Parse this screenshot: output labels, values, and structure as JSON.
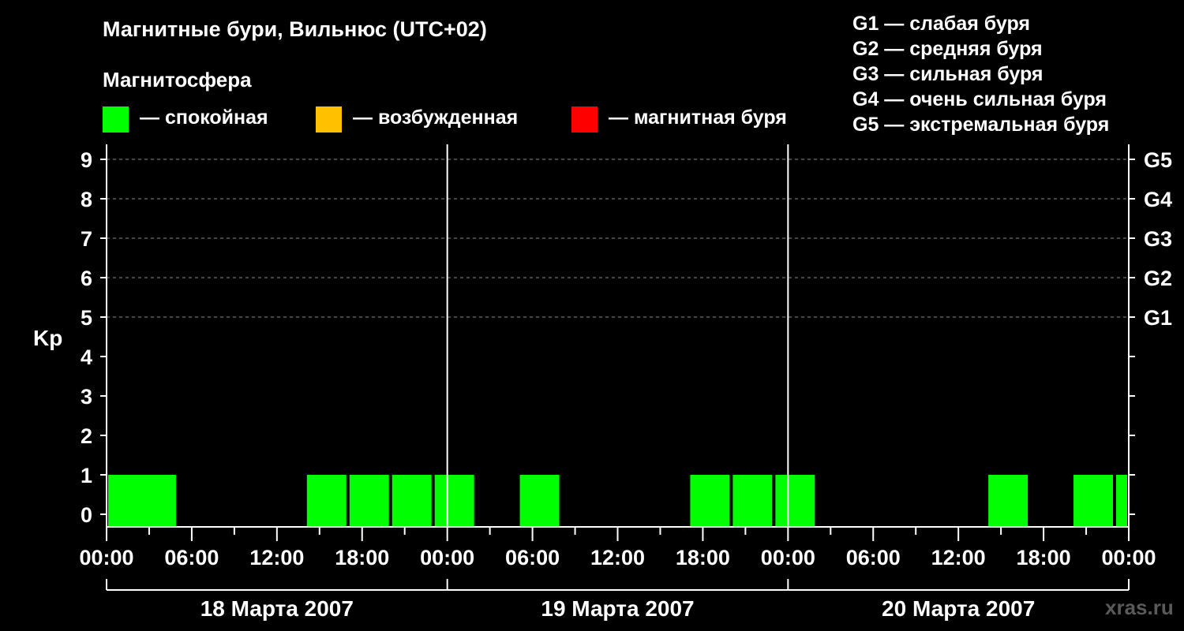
{
  "header": {
    "title": "Магнитные бури, Вильнюс (UTC+02)",
    "subtitle": "Магнитосфера",
    "watermark": "xras.ru"
  },
  "legend": [
    {
      "label": "— спокойная",
      "color": "#00ff00"
    },
    {
      "label": "— возбужденная",
      "color": "#ffc000"
    },
    {
      "label": "— магнитная буря",
      "color": "#ff0000"
    }
  ],
  "g_legend": [
    "G1 — слабая буря",
    "G2 — средняя буря",
    "G3 — сильная буря",
    "G4 — очень сильная буря",
    "G5 — экстремальная буря"
  ],
  "chart_data": {
    "type": "bar",
    "ylabel": "Kp",
    "ylim": [
      0,
      9
    ],
    "y_ticks": [
      "0",
      "1",
      "2",
      "3",
      "4",
      "5",
      "6",
      "7",
      "8",
      "9"
    ],
    "right_ticks": [
      {
        "kp": 5,
        "label": "G1"
      },
      {
        "kp": 6,
        "label": "G2"
      },
      {
        "kp": 7,
        "label": "G3"
      },
      {
        "kp": 8,
        "label": "G4"
      },
      {
        "kp": 9,
        "label": "G5"
      }
    ],
    "x_tick_labels": [
      "00:00",
      "06:00",
      "12:00",
      "18:00",
      "00:00",
      "06:00",
      "12:00",
      "18:00",
      "00:00",
      "06:00",
      "12:00",
      "18:00",
      "00:00"
    ],
    "days": [
      "18 Марта 2007",
      "19 Марта 2007",
      "20 Марта 2007"
    ],
    "bar_hours": 3,
    "bar_color": "#00ff00",
    "bars": [
      {
        "start_hour": 0,
        "kp": 1
      },
      {
        "start_hour": 2,
        "kp": 1
      },
      {
        "start_hour": 14,
        "kp": 1
      },
      {
        "start_hour": 17,
        "kp": 1
      },
      {
        "start_hour": 20,
        "kp": 1
      },
      {
        "start_hour": 23,
        "kp": 1
      },
      {
        "start_hour": 29,
        "kp": 1
      },
      {
        "start_hour": 41,
        "kp": 1
      },
      {
        "start_hour": 44,
        "kp": 1
      },
      {
        "start_hour": 47,
        "kp": 1
      },
      {
        "start_hour": 62,
        "kp": 1
      },
      {
        "start_hour": 68,
        "kp": 1
      },
      {
        "start_hour": 71,
        "kp": 1
      }
    ],
    "grid": "dashed horizontal at Kp 5–9"
  }
}
